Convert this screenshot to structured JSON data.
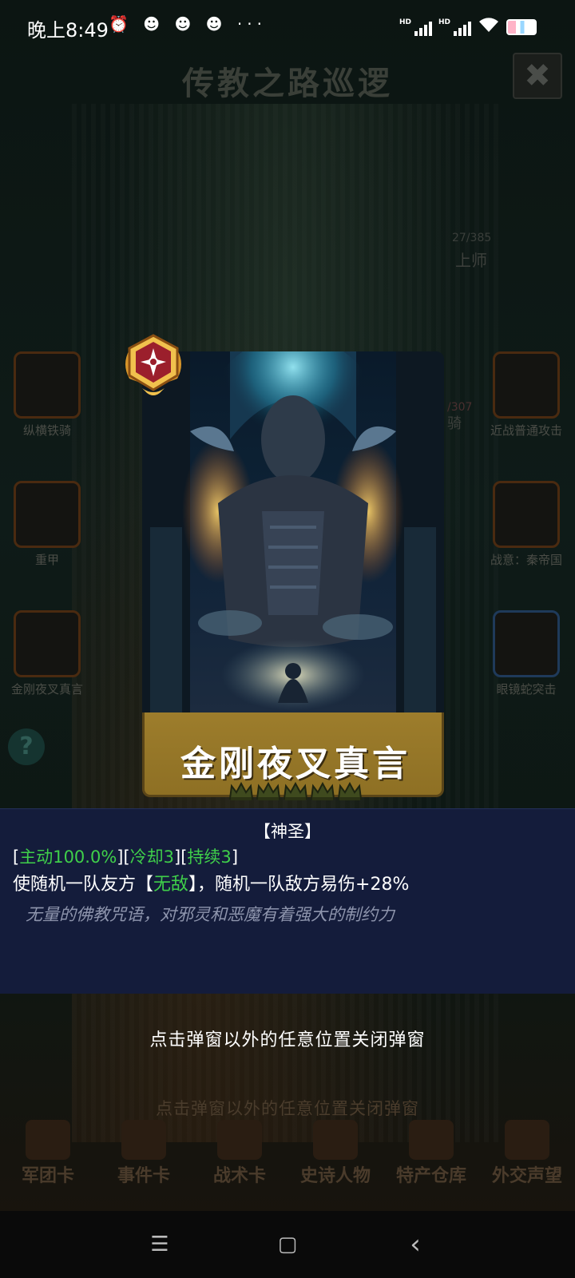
{
  "status_bar": {
    "time": "晚上8:49",
    "extra_icons": "⏰ ☻ ☻ ☻ ···",
    "signal_label": "HD"
  },
  "background": {
    "title": "传教之路巡逻",
    "close_glyph": "✖",
    "left_units": [
      "纵横铁骑",
      "重甲",
      "金刚夜叉真言"
    ],
    "right_units": [
      "近战普通攻击",
      "战意：秦帝国",
      "眼镜蛇突击"
    ],
    "troop_count": "27/385",
    "rank": "上师",
    "partial_count": "/307",
    "partial_label": "骑",
    "help_glyph": "?",
    "hint": "点击弹窗以外的任意位置关闭弹窗",
    "nav": [
      "军团卡",
      "事件卡",
      "战术卡",
      "史诗人物",
      "特产仓库",
      "外交声望"
    ]
  },
  "card": {
    "name": "金刚夜叉真言",
    "stars": 5,
    "badge_icon": "compass-star-badge-icon"
  },
  "info": {
    "type": "【神圣】",
    "active": "主动100.0%",
    "cooldown": "冷却3",
    "duration": "持续3",
    "desc_before": "使随机一队友方【",
    "desc_keyword": "无敌",
    "desc_after": "】，随机一队敌方易伤+28%",
    "flavor": "无量的佛教咒语，对邪灵和恶魔有着强大的制约力"
  },
  "hint": "点击弹窗以外的任意位置关闭弹窗",
  "system_nav": {
    "menu_glyph": "☰",
    "home_glyph": "▢",
    "back_glyph": "‹"
  },
  "colors": {
    "panel_bg": "#141c3b",
    "highlight_green": "#3fcf4a",
    "card_gold": "#9d7d2c"
  }
}
